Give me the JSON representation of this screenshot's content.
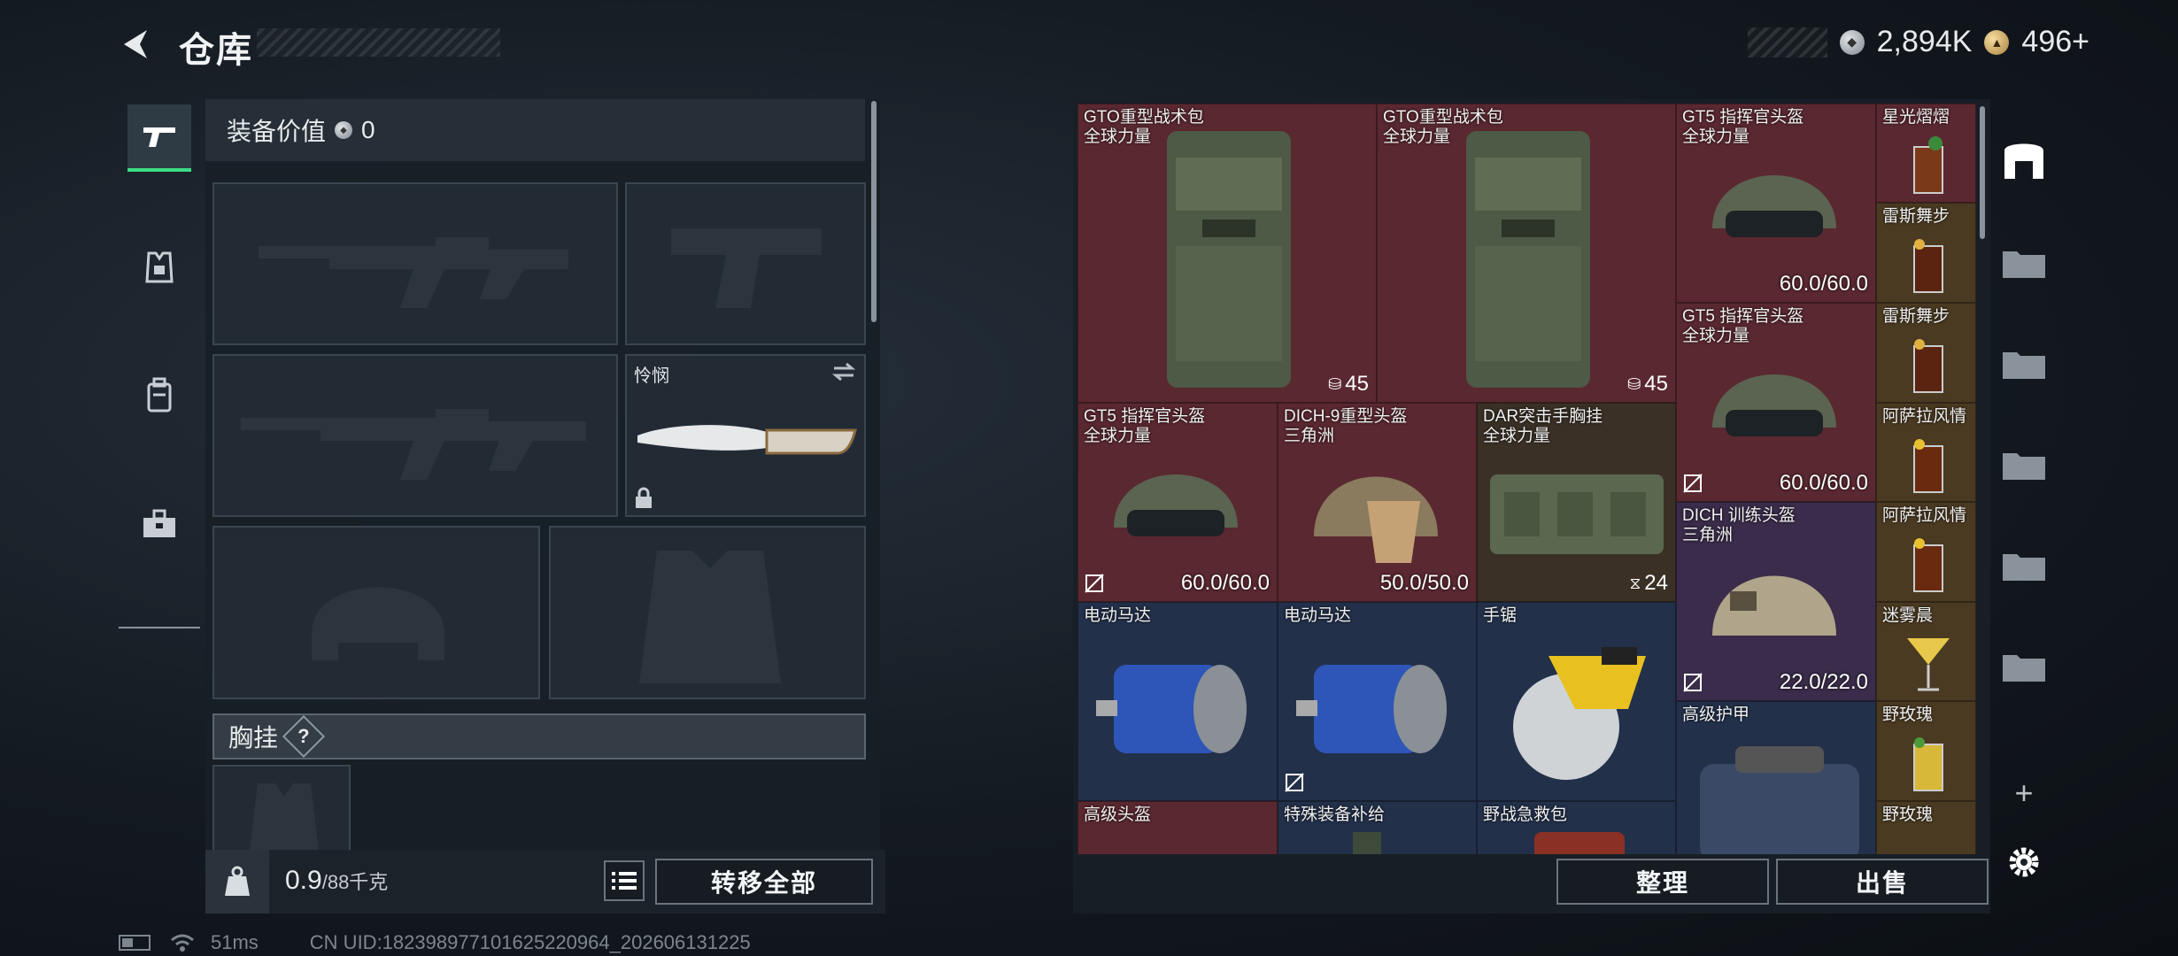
{
  "header": {
    "title": "仓库"
  },
  "currency": {
    "silver": "2,894K",
    "gold": "496",
    "gold_plus": "+"
  },
  "loadout": {
    "equip_value_label": "装备价值",
    "equip_value": "0",
    "melee_name": "怜悯",
    "chest_rig_label": "胸挂",
    "help_glyph": "?",
    "weight_value": "0.9",
    "weight_max": "/88千克",
    "transfer_all": "转移全部"
  },
  "stash": {
    "sort_label": "整理",
    "sell_label": "出售",
    "items": [
      {
        "name": "GTO重型战术包",
        "sub": "全球力量",
        "capacity": "45"
      },
      {
        "name": "GTO重型战术包",
        "sub": "全球力量",
        "capacity": "45"
      },
      {
        "name": "GT5 指挥官头盔",
        "sub": "全球力量",
        "durability": "60.0/60.0"
      },
      {
        "name": "星光熠熠"
      },
      {
        "name": "雷斯舞步"
      },
      {
        "name": "GT5 指挥官头盔",
        "sub": "全球力量",
        "durability": "60.0/60.0"
      },
      {
        "name": "雷斯舞步"
      },
      {
        "name": "GT5 指挥官头盔",
        "sub": "全球力量",
        "durability": "60.0/60.0"
      },
      {
        "name": "DICH-9重型头盔",
        "sub": "三角洲",
        "durability": "50.0/50.0"
      },
      {
        "name": "DAR突击手胸挂",
        "sub": "全球力量",
        "capacity": "24"
      },
      {
        "name": "阿萨拉风情"
      },
      {
        "name": "DICH 训练头盔",
        "sub": "三角洲",
        "durability": "22.0/22.0"
      },
      {
        "name": "阿萨拉风情"
      },
      {
        "name": "电动马达"
      },
      {
        "name": "电动马达"
      },
      {
        "name": "手锯"
      },
      {
        "name": "迷雾晨"
      },
      {
        "name": "高级护甲"
      },
      {
        "name": "野玫瑰"
      },
      {
        "name": "野玫瑰"
      },
      {
        "name": "高级头盔"
      },
      {
        "name": "特殊装备补给"
      },
      {
        "name": "野战急救包"
      }
    ]
  },
  "rightnav": {
    "plus": "+"
  },
  "statusbar": {
    "ping": "51ms",
    "uid": "CN UID:1823989771016252209​64_202606131225"
  },
  "colors": {
    "accent": "#3ddc84",
    "rare_red": "#5a2830",
    "rare_blue": "#22304a",
    "rare_gold": "#4a3a22"
  }
}
